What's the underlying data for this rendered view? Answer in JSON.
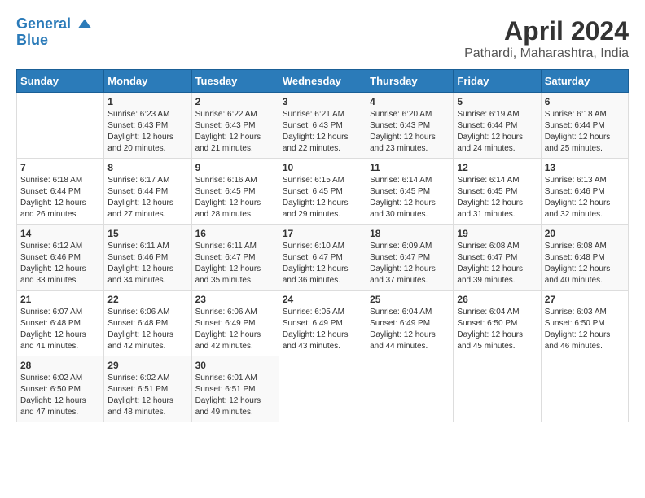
{
  "logo": {
    "line1": "General",
    "line2": "Blue"
  },
  "title": "April 2024",
  "subtitle": "Pathardi, Maharashtra, India",
  "days_header": [
    "Sunday",
    "Monday",
    "Tuesday",
    "Wednesday",
    "Thursday",
    "Friday",
    "Saturday"
  ],
  "weeks": [
    [
      {
        "day": "",
        "sunrise": "",
        "sunset": "",
        "daylight": ""
      },
      {
        "day": "1",
        "sunrise": "Sunrise: 6:23 AM",
        "sunset": "Sunset: 6:43 PM",
        "daylight": "Daylight: 12 hours and 20 minutes."
      },
      {
        "day": "2",
        "sunrise": "Sunrise: 6:22 AM",
        "sunset": "Sunset: 6:43 PM",
        "daylight": "Daylight: 12 hours and 21 minutes."
      },
      {
        "day": "3",
        "sunrise": "Sunrise: 6:21 AM",
        "sunset": "Sunset: 6:43 PM",
        "daylight": "Daylight: 12 hours and 22 minutes."
      },
      {
        "day": "4",
        "sunrise": "Sunrise: 6:20 AM",
        "sunset": "Sunset: 6:43 PM",
        "daylight": "Daylight: 12 hours and 23 minutes."
      },
      {
        "day": "5",
        "sunrise": "Sunrise: 6:19 AM",
        "sunset": "Sunset: 6:44 PM",
        "daylight": "Daylight: 12 hours and 24 minutes."
      },
      {
        "day": "6",
        "sunrise": "Sunrise: 6:18 AM",
        "sunset": "Sunset: 6:44 PM",
        "daylight": "Daylight: 12 hours and 25 minutes."
      }
    ],
    [
      {
        "day": "7",
        "sunrise": "Sunrise: 6:18 AM",
        "sunset": "Sunset: 6:44 PM",
        "daylight": "Daylight: 12 hours and 26 minutes."
      },
      {
        "day": "8",
        "sunrise": "Sunrise: 6:17 AM",
        "sunset": "Sunset: 6:44 PM",
        "daylight": "Daylight: 12 hours and 27 minutes."
      },
      {
        "day": "9",
        "sunrise": "Sunrise: 6:16 AM",
        "sunset": "Sunset: 6:45 PM",
        "daylight": "Daylight: 12 hours and 28 minutes."
      },
      {
        "day": "10",
        "sunrise": "Sunrise: 6:15 AM",
        "sunset": "Sunset: 6:45 PM",
        "daylight": "Daylight: 12 hours and 29 minutes."
      },
      {
        "day": "11",
        "sunrise": "Sunrise: 6:14 AM",
        "sunset": "Sunset: 6:45 PM",
        "daylight": "Daylight: 12 hours and 30 minutes."
      },
      {
        "day": "12",
        "sunrise": "Sunrise: 6:14 AM",
        "sunset": "Sunset: 6:45 PM",
        "daylight": "Daylight: 12 hours and 31 minutes."
      },
      {
        "day": "13",
        "sunrise": "Sunrise: 6:13 AM",
        "sunset": "Sunset: 6:46 PM",
        "daylight": "Daylight: 12 hours and 32 minutes."
      }
    ],
    [
      {
        "day": "14",
        "sunrise": "Sunrise: 6:12 AM",
        "sunset": "Sunset: 6:46 PM",
        "daylight": "Daylight: 12 hours and 33 minutes."
      },
      {
        "day": "15",
        "sunrise": "Sunrise: 6:11 AM",
        "sunset": "Sunset: 6:46 PM",
        "daylight": "Daylight: 12 hours and 34 minutes."
      },
      {
        "day": "16",
        "sunrise": "Sunrise: 6:11 AM",
        "sunset": "Sunset: 6:47 PM",
        "daylight": "Daylight: 12 hours and 35 minutes."
      },
      {
        "day": "17",
        "sunrise": "Sunrise: 6:10 AM",
        "sunset": "Sunset: 6:47 PM",
        "daylight": "Daylight: 12 hours and 36 minutes."
      },
      {
        "day": "18",
        "sunrise": "Sunrise: 6:09 AM",
        "sunset": "Sunset: 6:47 PM",
        "daylight": "Daylight: 12 hours and 37 minutes."
      },
      {
        "day": "19",
        "sunrise": "Sunrise: 6:08 AM",
        "sunset": "Sunset: 6:47 PM",
        "daylight": "Daylight: 12 hours and 39 minutes."
      },
      {
        "day": "20",
        "sunrise": "Sunrise: 6:08 AM",
        "sunset": "Sunset: 6:48 PM",
        "daylight": "Daylight: 12 hours and 40 minutes."
      }
    ],
    [
      {
        "day": "21",
        "sunrise": "Sunrise: 6:07 AM",
        "sunset": "Sunset: 6:48 PM",
        "daylight": "Daylight: 12 hours and 41 minutes."
      },
      {
        "day": "22",
        "sunrise": "Sunrise: 6:06 AM",
        "sunset": "Sunset: 6:48 PM",
        "daylight": "Daylight: 12 hours and 42 minutes."
      },
      {
        "day": "23",
        "sunrise": "Sunrise: 6:06 AM",
        "sunset": "Sunset: 6:49 PM",
        "daylight": "Daylight: 12 hours and 42 minutes."
      },
      {
        "day": "24",
        "sunrise": "Sunrise: 6:05 AM",
        "sunset": "Sunset: 6:49 PM",
        "daylight": "Daylight: 12 hours and 43 minutes."
      },
      {
        "day": "25",
        "sunrise": "Sunrise: 6:04 AM",
        "sunset": "Sunset: 6:49 PM",
        "daylight": "Daylight: 12 hours and 44 minutes."
      },
      {
        "day": "26",
        "sunrise": "Sunrise: 6:04 AM",
        "sunset": "Sunset: 6:50 PM",
        "daylight": "Daylight: 12 hours and 45 minutes."
      },
      {
        "day": "27",
        "sunrise": "Sunrise: 6:03 AM",
        "sunset": "Sunset: 6:50 PM",
        "daylight": "Daylight: 12 hours and 46 minutes."
      }
    ],
    [
      {
        "day": "28",
        "sunrise": "Sunrise: 6:02 AM",
        "sunset": "Sunset: 6:50 PM",
        "daylight": "Daylight: 12 hours and 47 minutes."
      },
      {
        "day": "29",
        "sunrise": "Sunrise: 6:02 AM",
        "sunset": "Sunset: 6:51 PM",
        "daylight": "Daylight: 12 hours and 48 minutes."
      },
      {
        "day": "30",
        "sunrise": "Sunrise: 6:01 AM",
        "sunset": "Sunset: 6:51 PM",
        "daylight": "Daylight: 12 hours and 49 minutes."
      },
      {
        "day": "",
        "sunrise": "",
        "sunset": "",
        "daylight": ""
      },
      {
        "day": "",
        "sunrise": "",
        "sunset": "",
        "daylight": ""
      },
      {
        "day": "",
        "sunrise": "",
        "sunset": "",
        "daylight": ""
      },
      {
        "day": "",
        "sunrise": "",
        "sunset": "",
        "daylight": ""
      }
    ]
  ]
}
